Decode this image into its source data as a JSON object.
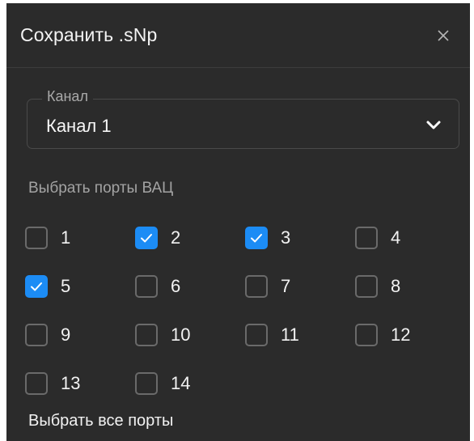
{
  "dialog": {
    "title": "Сохранить .sNp",
    "close_icon": "close-icon"
  },
  "channel": {
    "label": "Канал",
    "value": "Канал 1",
    "dropdown_icon": "chevron-down-icon"
  },
  "ports": {
    "label": "Выбрать порты ВАЦ",
    "items": [
      {
        "label": "1",
        "checked": false
      },
      {
        "label": "2",
        "checked": true
      },
      {
        "label": "3",
        "checked": true
      },
      {
        "label": "4",
        "checked": false
      },
      {
        "label": "5",
        "checked": true
      },
      {
        "label": "6",
        "checked": false
      },
      {
        "label": "7",
        "checked": false
      },
      {
        "label": "8",
        "checked": false
      },
      {
        "label": "9",
        "checked": false
      },
      {
        "label": "10",
        "checked": false
      },
      {
        "label": "11",
        "checked": false
      },
      {
        "label": "12",
        "checked": false
      },
      {
        "label": "13",
        "checked": false
      },
      {
        "label": "14",
        "checked": false
      }
    ],
    "select_all_label": "Выбрать все порты"
  },
  "colors": {
    "background": "#2b2b2b",
    "accent": "#1c8cf5"
  }
}
